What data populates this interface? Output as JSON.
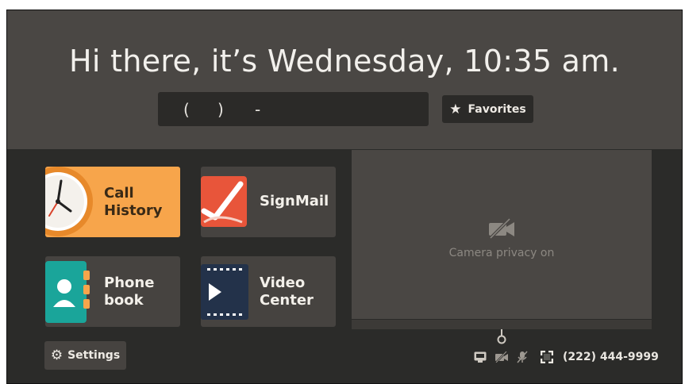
{
  "header": {
    "greeting": "Hi there, it’s Wednesday, 10:35 am.",
    "dial_open_paren": "(",
    "dial_close_paren": ")",
    "dial_dash": "-",
    "favorites_label": "Favorites"
  },
  "tiles": [
    {
      "label_line1": "Call",
      "label_line2": "History",
      "icon": "clock-icon",
      "active": true
    },
    {
      "label": "SignMail",
      "icon": "signmail-icon"
    },
    {
      "label_line1": "Phone",
      "label_line2": "book",
      "icon": "phonebook-icon"
    },
    {
      "label_line1": "Video",
      "label_line2": "Center",
      "icon": "video-center-icon"
    }
  ],
  "preview": {
    "privacy_text": "Camera privacy on",
    "icon": "camera-off-icon"
  },
  "footer": {
    "settings_label": "Settings",
    "phone_number": "(222) 444-9999",
    "status_icons": [
      "network-icon",
      "camera-off-icon",
      "mic-off-icon",
      "fullscreen-icon"
    ]
  },
  "colors": {
    "accent_orange": "#f7a54b",
    "signmail_red": "#e8553a",
    "phonebook_teal": "#1aa59a",
    "video_navy": "#23324a",
    "background": "#2b2b29",
    "header": "#4a4744"
  }
}
